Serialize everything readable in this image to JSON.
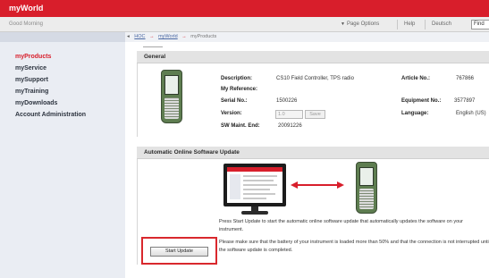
{
  "header": {
    "brand": "myWorld"
  },
  "subbar": {
    "greeting": "Good Morning",
    "greeting_name": "",
    "page_options": "Page Options",
    "help": "Help",
    "language": "Deutsch",
    "find_value": "Find"
  },
  "breadcrumb": {
    "items": [
      "HOC",
      "myWorld",
      "myProducts"
    ]
  },
  "sidebar": {
    "items": [
      {
        "label": "myProducts",
        "active": true
      },
      {
        "label": "myService",
        "active": false
      },
      {
        "label": "mySupport",
        "active": false
      },
      {
        "label": "myTraining",
        "active": false
      },
      {
        "label": "myDownloads",
        "active": false
      },
      {
        "label": "Account Administration",
        "active": false
      }
    ]
  },
  "general": {
    "title": "General",
    "description_label": "Description:",
    "description_value": "CS10 Field Controller, TPS radio",
    "reference_label": "My Reference:",
    "serial_label": "Serial No.:",
    "serial_value": "1500226",
    "version_label": "Version:",
    "version_value": "1.0",
    "save_label": "Save",
    "sw_label": "SW Maint. End:",
    "sw_value": "20091226",
    "article_label": "Article No.:",
    "article_value": "767866",
    "equipment_label": "Equipment No.:",
    "equipment_value": "3577897",
    "language_label": "Language:",
    "language_value": "English (US)"
  },
  "update": {
    "title": "Automatic Online Software Update",
    "text1": "Press Start Update to start the automatic online software update that automatically updates the software on your",
    "text2": "instrument.",
    "text3": "Please make sure that the battery of your instrument is loaded more than 50% and that the connection is not interrupted until",
    "text4": "the software update is completed.",
    "start_button": "Start Update"
  },
  "colors": {
    "brand_red": "#d81e2b",
    "sidebar_bg": "#eaedf3"
  }
}
